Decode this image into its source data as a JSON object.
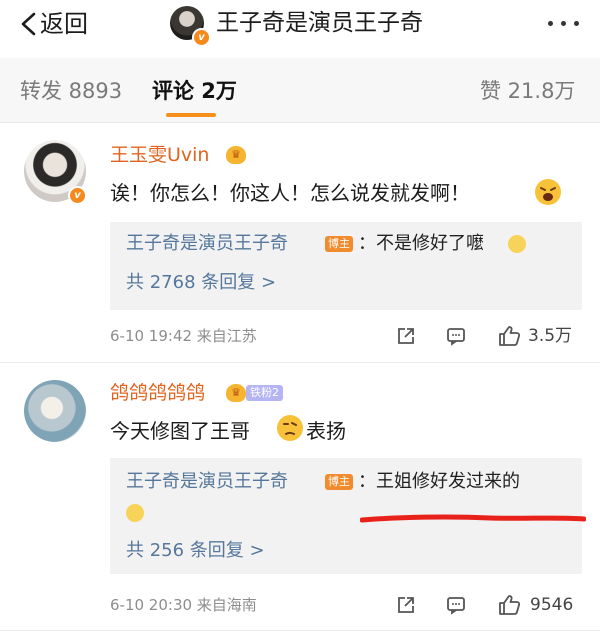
{
  "header": {
    "back_label": "返回",
    "title": "王子奇是演员王子奇"
  },
  "tabs": {
    "forward": "转发 8893",
    "comment": "评论 2万",
    "like": "赞 21.8万"
  },
  "comments": [
    {
      "username": "王玉雯Uvin",
      "text": "诶！你怎么！你这人！怎么说发就发啊！",
      "reply": {
        "author": "王子奇是演员王子奇",
        "badge": "博主",
        "text": "：不是修好了嚒",
        "count": "共 2768 条回复 >"
      },
      "meta": "6-10 19:42  来自江苏",
      "likes": "3.5万"
    },
    {
      "username": "鸽鸽鸽鸽鸽",
      "fan_badge": "铁粉2",
      "text_a": "今天修图了王哥",
      "text_b": "表扬",
      "reply": {
        "author": "王子奇是演员王子奇",
        "badge": "博主",
        "text": "：王姐修好发过来的",
        "count": "共 256 条回复 >"
      },
      "meta": "6-10 20:30  来自海南",
      "likes": "9546"
    }
  ],
  "colors": {
    "accent": "#f5901b",
    "username": "#e0641f",
    "reply_link": "#56779c",
    "annotation": "#e8221b"
  }
}
